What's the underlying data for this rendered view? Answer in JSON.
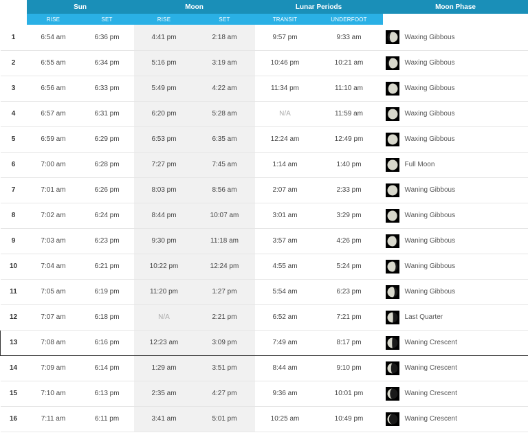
{
  "headers": {
    "sun": "Sun",
    "moon": "Moon",
    "lunar_periods": "Lunar Periods",
    "moon_phase": "Moon Phase",
    "rise": "RISE",
    "set": "SET",
    "moon_rise": "RISE",
    "moon_set": "SET",
    "transit": "TRANSIT",
    "underfoot": "UNDERFOOT"
  },
  "rows": [
    {
      "day": "1",
      "sunrise": "6:54 am",
      "sunset": "6:36 pm",
      "moonrise": "4:41 pm",
      "moonset": "2:18 am",
      "transit": "9:57 pm",
      "underfoot": "9:33 am",
      "phase": "Waxing Gibbous",
      "illum": 0.78,
      "waxing": true
    },
    {
      "day": "2",
      "sunrise": "6:55 am",
      "sunset": "6:34 pm",
      "moonrise": "5:16 pm",
      "moonset": "3:19 am",
      "transit": "10:46 pm",
      "underfoot": "10:21 am",
      "phase": "Waxing Gibbous",
      "illum": 0.85,
      "waxing": true
    },
    {
      "day": "3",
      "sunrise": "6:56 am",
      "sunset": "6:33 pm",
      "moonrise": "5:49 pm",
      "moonset": "4:22 am",
      "transit": "11:34 pm",
      "underfoot": "11:10 am",
      "phase": "Waxing Gibbous",
      "illum": 0.91,
      "waxing": true
    },
    {
      "day": "4",
      "sunrise": "6:57 am",
      "sunset": "6:31 pm",
      "moonrise": "6:20 pm",
      "moonset": "5:28 am",
      "transit": "N/A",
      "underfoot": "11:59 am",
      "phase": "Waxing Gibbous",
      "illum": 0.95,
      "waxing": true
    },
    {
      "day": "5",
      "sunrise": "6:59 am",
      "sunset": "6:29 pm",
      "moonrise": "6:53 pm",
      "moonset": "6:35 am",
      "transit": "12:24 am",
      "underfoot": "12:49 pm",
      "phase": "Waxing Gibbous",
      "illum": 0.98,
      "waxing": true
    },
    {
      "day": "6",
      "sunrise": "7:00 am",
      "sunset": "6:28 pm",
      "moonrise": "7:27 pm",
      "moonset": "7:45 am",
      "transit": "1:14 am",
      "underfoot": "1:40 pm",
      "phase": "Full Moon",
      "illum": 1.0,
      "waxing": true
    },
    {
      "day": "7",
      "sunrise": "7:01 am",
      "sunset": "6:26 pm",
      "moonrise": "8:03 pm",
      "moonset": "8:56 am",
      "transit": "2:07 am",
      "underfoot": "2:33 pm",
      "phase": "Waning Gibbous",
      "illum": 0.98,
      "waxing": false
    },
    {
      "day": "8",
      "sunrise": "7:02 am",
      "sunset": "6:24 pm",
      "moonrise": "8:44 pm",
      "moonset": "10:07 am",
      "transit": "3:01 am",
      "underfoot": "3:29 pm",
      "phase": "Waning Gibbous",
      "illum": 0.94,
      "waxing": false
    },
    {
      "day": "9",
      "sunrise": "7:03 am",
      "sunset": "6:23 pm",
      "moonrise": "9:30 pm",
      "moonset": "11:18 am",
      "transit": "3:57 am",
      "underfoot": "4:26 pm",
      "phase": "Waning Gibbous",
      "illum": 0.88,
      "waxing": false
    },
    {
      "day": "10",
      "sunrise": "7:04 am",
      "sunset": "6:21 pm",
      "moonrise": "10:22 pm",
      "moonset": "12:24 pm",
      "transit": "4:55 am",
      "underfoot": "5:24 pm",
      "phase": "Waning Gibbous",
      "illum": 0.8,
      "waxing": false
    },
    {
      "day": "11",
      "sunrise": "7:05 am",
      "sunset": "6:19 pm",
      "moonrise": "11:20 pm",
      "moonset": "1:27 pm",
      "transit": "5:54 am",
      "underfoot": "6:23 pm",
      "phase": "Waning Gibbous",
      "illum": 0.7,
      "waxing": false
    },
    {
      "day": "12",
      "sunrise": "7:07 am",
      "sunset": "6:18 pm",
      "moonrise": "N/A",
      "moonset": "2:21 pm",
      "transit": "6:52 am",
      "underfoot": "7:21 pm",
      "phase": "Last Quarter",
      "illum": 0.55,
      "waxing": false
    },
    {
      "day": "13",
      "sunrise": "7:08 am",
      "sunset": "6:16 pm",
      "moonrise": "12:23 am",
      "moonset": "3:09 pm",
      "transit": "7:49 am",
      "underfoot": "8:17 pm",
      "phase": "Waning Crescent",
      "illum": 0.45,
      "waxing": false,
      "today": true
    },
    {
      "day": "14",
      "sunrise": "7:09 am",
      "sunset": "6:14 pm",
      "moonrise": "1:29 am",
      "moonset": "3:51 pm",
      "transit": "8:44 am",
      "underfoot": "9:10 pm",
      "phase": "Waning Crescent",
      "illum": 0.35,
      "waxing": false
    },
    {
      "day": "15",
      "sunrise": "7:10 am",
      "sunset": "6:13 pm",
      "moonrise": "2:35 am",
      "moonset": "4:27 pm",
      "transit": "9:36 am",
      "underfoot": "10:01 pm",
      "phase": "Waning Crescent",
      "illum": 0.25,
      "waxing": false
    },
    {
      "day": "16",
      "sunrise": "7:11 am",
      "sunset": "6:11 pm",
      "moonrise": "3:41 am",
      "moonset": "5:01 pm",
      "transit": "10:25 am",
      "underfoot": "10:49 pm",
      "phase": "Waning Crescent",
      "illum": 0.16,
      "waxing": false
    }
  ]
}
